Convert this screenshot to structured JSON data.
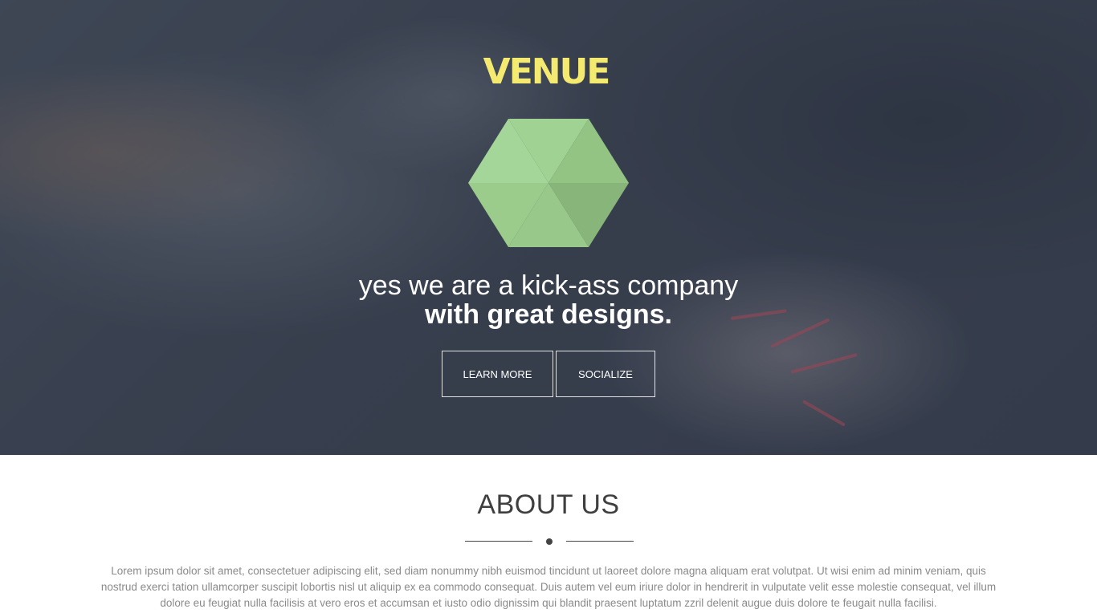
{
  "hero": {
    "logo_text": "VENUE",
    "headline_light": "yes we are a kick-ass company",
    "headline_bold": "with great designs.",
    "buttons": {
      "learn_more": "LEARN MORE",
      "socialize": "SOCIALIZE"
    }
  },
  "about": {
    "title": "ABOUT US",
    "text": "Lorem ipsum dolor sit amet, consectetuer adipiscing elit, sed diam nonummy nibh euismod tincidunt ut laoreet dolore magna aliquam erat volutpat. Ut wisi enim ad minim veniam, quis nostrud exerci tation ullamcorper suscipit lobortis nisl ut aliquip ex ea commodo consequat. Duis autem vel eum iriure dolor in hendrerit in vulputate velit esse molestie consequat, vel illum dolore eu feugiat nulla facilisis at vero eros et accumsan et iusto odio dignissim qui blandit praesent luptatum zzril delenit augue duis dolore te feugait nulla facilisi."
  },
  "colors": {
    "logo": "#f4ea6f",
    "hexagon": "#9ccc8c",
    "hero_overlay": "#2e3644"
  },
  "icons": {
    "hexagon": "hexagon-logo-icon"
  }
}
